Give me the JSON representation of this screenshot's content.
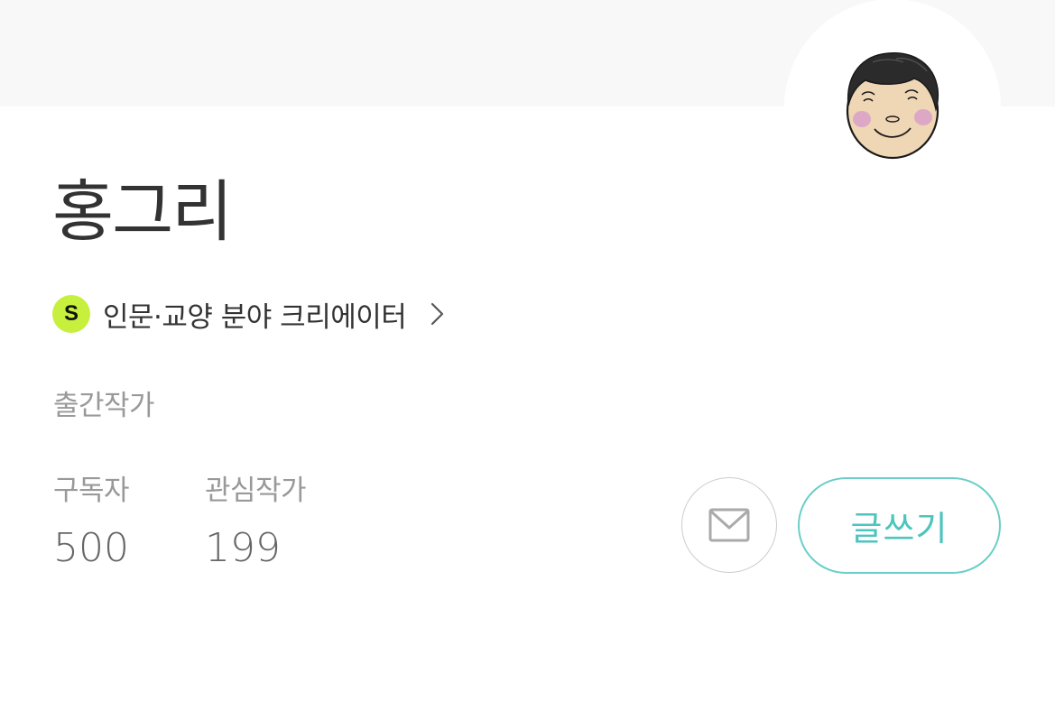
{
  "profile": {
    "name": "홍그리",
    "creator_badge": "S",
    "creator_label": "인문·교양 분야 크리에이터",
    "tag": "출간작가",
    "stats": {
      "subscribers_label": "구독자",
      "subscribers_value": "500",
      "following_label": "관심작가",
      "following_value": "199"
    }
  },
  "actions": {
    "mail_icon": "envelope-icon",
    "write_label": "글쓰기"
  },
  "colors": {
    "accent": "#4cc5bc",
    "badge": "#c6f03d",
    "top_band": "#f8f8f8"
  },
  "icons": {
    "chevron": "chevron-right-icon",
    "avatar": "cartoon-face-avatar"
  }
}
